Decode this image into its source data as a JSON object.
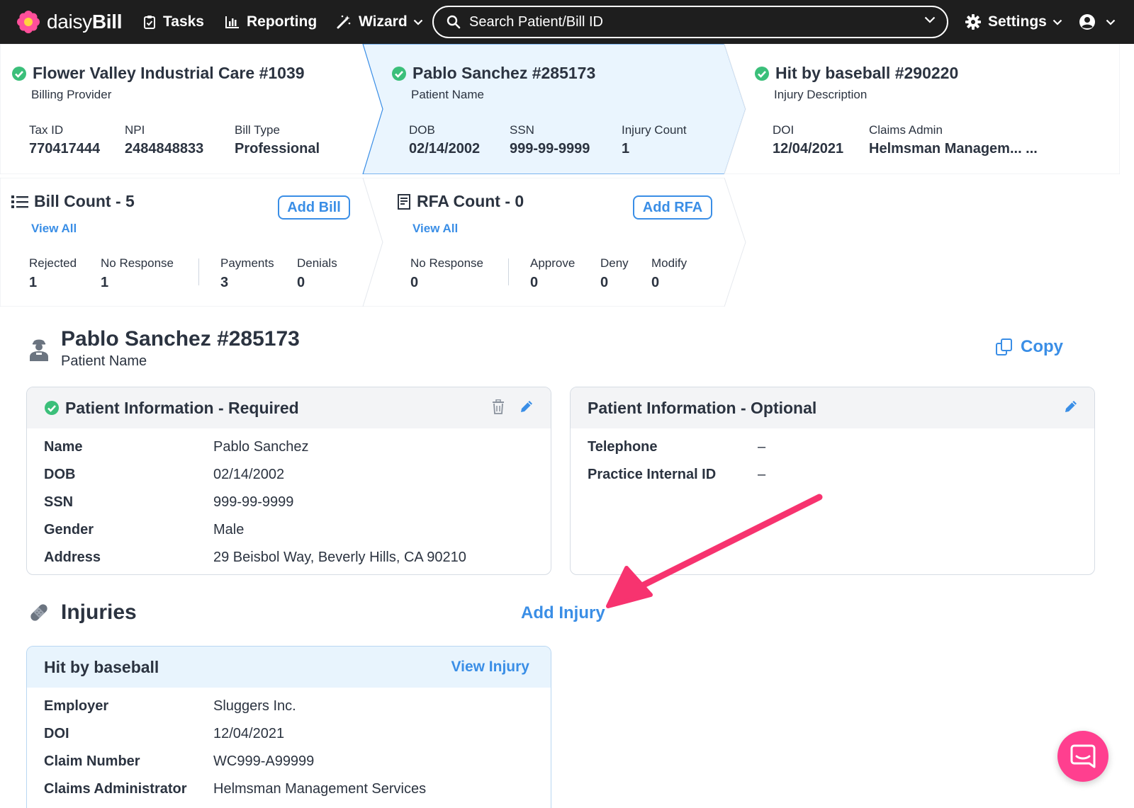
{
  "nav": {
    "brand_light": "daisy",
    "brand_bold": "Bill",
    "tasks": "Tasks",
    "reporting": "Reporting",
    "wizard": "Wizard",
    "search_placeholder": "Search Patient/Bill ID",
    "settings": "Settings"
  },
  "summary": {
    "provider": {
      "title": "Flower Valley Industrial Care #1039",
      "subtitle": "Billing Provider",
      "fields": [
        {
          "label": "Tax ID",
          "value": "770417444"
        },
        {
          "label": "NPI",
          "value": "2484848833"
        },
        {
          "label": "Bill Type",
          "value": "Professional"
        }
      ]
    },
    "patient": {
      "title": "Pablo Sanchez #285173",
      "subtitle": "Patient Name",
      "fields": [
        {
          "label": "DOB",
          "value": "02/14/2002"
        },
        {
          "label": "SSN",
          "value": "999-99-9999"
        },
        {
          "label": "Injury Count",
          "value": "1"
        }
      ]
    },
    "injury": {
      "title": "Hit by baseball #290220",
      "subtitle": "Injury Description",
      "fields": [
        {
          "label": "DOI",
          "value": "12/04/2021"
        },
        {
          "label": "Claims Admin",
          "value": "Helmsman Managem... ..."
        }
      ]
    },
    "bills": {
      "title": "Bill Count - 5",
      "view_all": "View All",
      "add_label": "Add Bill",
      "fields": [
        {
          "label": "Rejected",
          "value": "1"
        },
        {
          "label": "No Response",
          "value": "1"
        },
        {
          "label": "Payments",
          "value": "3"
        },
        {
          "label": "Denials",
          "value": "0"
        }
      ]
    },
    "rfa": {
      "title": "RFA Count - 0",
      "view_all": "View All",
      "add_label": "Add RFA",
      "fields": [
        {
          "label": "No Response",
          "value": "0"
        },
        {
          "label": "Approve",
          "value": "0"
        },
        {
          "label": "Deny",
          "value": "0"
        },
        {
          "label": "Modify",
          "value": "0"
        }
      ]
    }
  },
  "patient_header": {
    "name": "Pablo Sanchez #285173",
    "subtitle": "Patient Name",
    "copy_label": "Copy"
  },
  "required_panel": {
    "title": "Patient Information - Required",
    "rows": [
      {
        "label": "Name",
        "value": "Pablo Sanchez"
      },
      {
        "label": "DOB",
        "value": "02/14/2002"
      },
      {
        "label": "SSN",
        "value": "999-99-9999"
      },
      {
        "label": "Gender",
        "value": "Male"
      },
      {
        "label": "Address",
        "value": "29 Beisbol Way, Beverly Hills, CA 90210"
      }
    ]
  },
  "optional_panel": {
    "title": "Patient Information - Optional",
    "rows": [
      {
        "label": "Telephone",
        "value": "–"
      },
      {
        "label": "Practice Internal ID",
        "value": "–"
      }
    ]
  },
  "injuries": {
    "title": "Injuries",
    "add_label": "Add Injury",
    "card": {
      "title": "Hit by baseball",
      "view_label": "View Injury",
      "rows": [
        {
          "label": "Employer",
          "value": "Sluggers Inc."
        },
        {
          "label": "DOI",
          "value": "12/04/2021"
        },
        {
          "label": "Claim Number",
          "value": "WC999-A99999"
        },
        {
          "label": "Claims Administrator",
          "value": "Helmsman Management Services"
        }
      ]
    }
  },
  "colors": {
    "accent": "#3a8ee6",
    "success": "#3bbf7a",
    "nav_bg": "#1e1e1e",
    "annotation_arrow": "#f7336f",
    "chat": "#ff3f8f"
  }
}
